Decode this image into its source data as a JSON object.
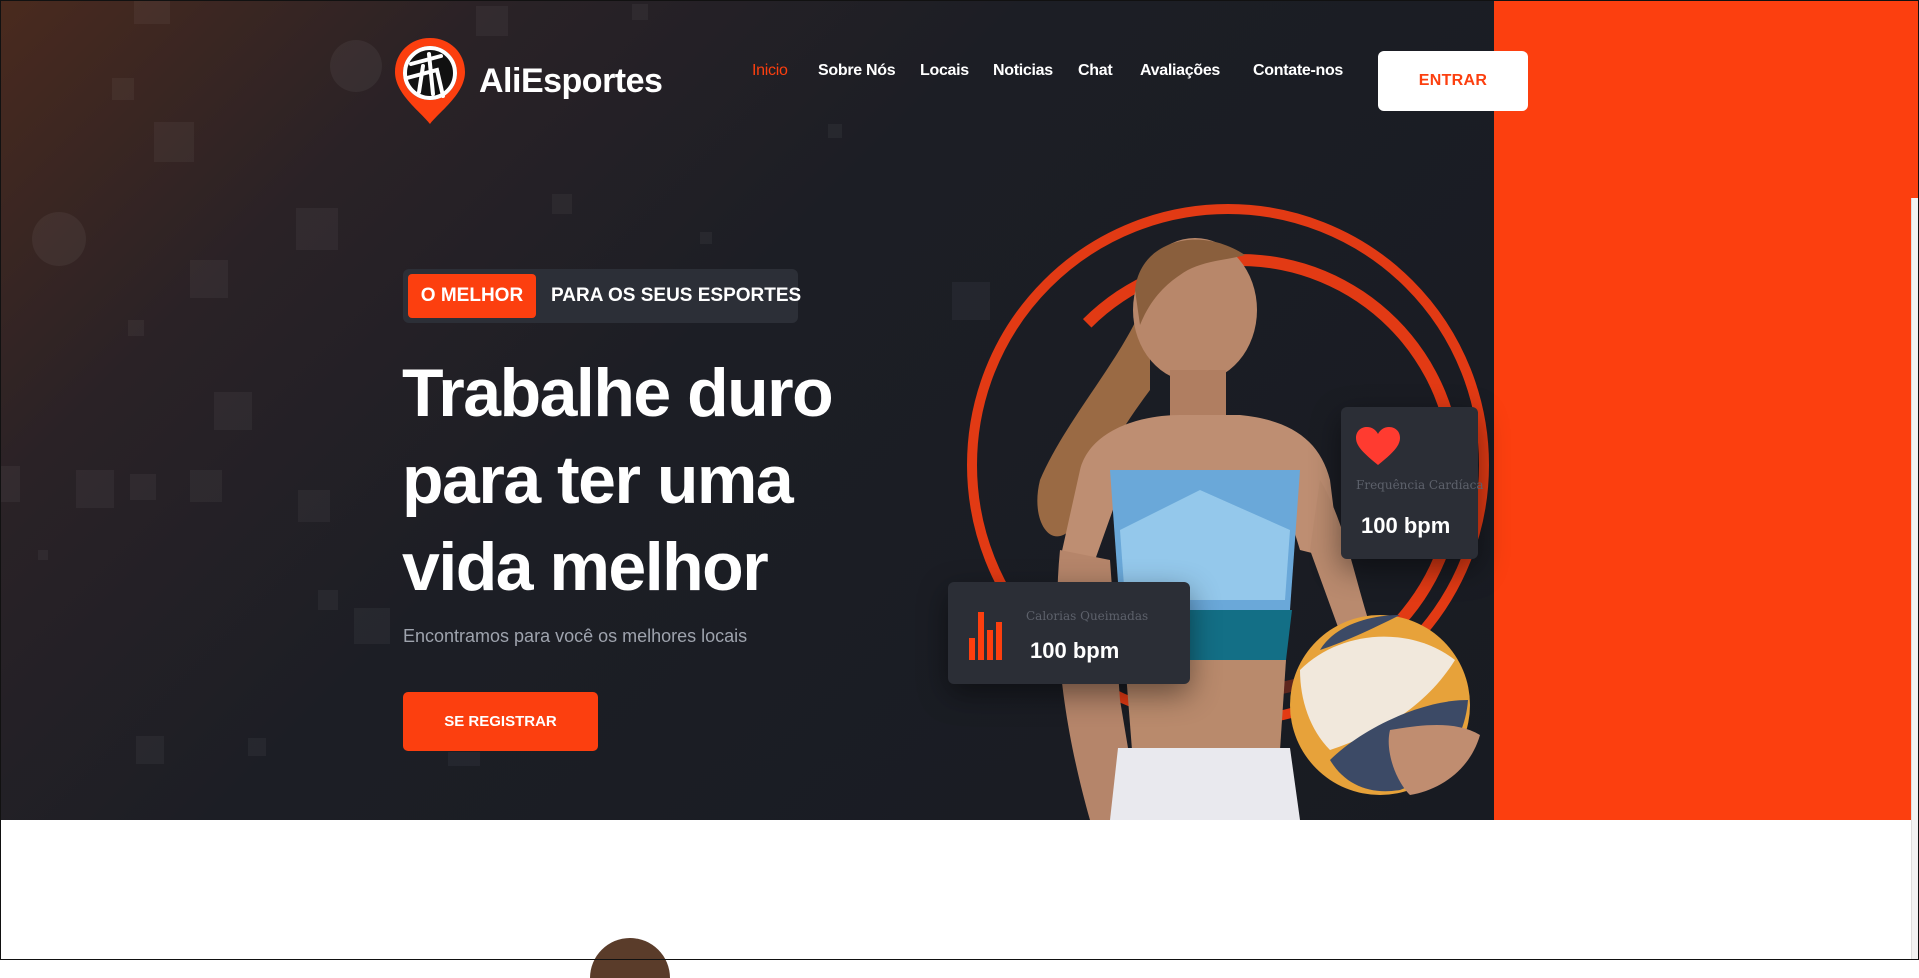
{
  "brand": {
    "name": "AliEsportes"
  },
  "nav": {
    "items": [
      {
        "label": "Inicio",
        "active": true
      },
      {
        "label": "Sobre Nós"
      },
      {
        "label": "Locais"
      },
      {
        "label": "Noticias"
      },
      {
        "label": "Chat"
      },
      {
        "label": "Avaliações"
      },
      {
        "label": "Contate-nos"
      }
    ],
    "login_label": "ENTRAR"
  },
  "hero": {
    "tag_highlight": "O MELHOR",
    "tag_rest": "PARA OS SEUS ESPORTES",
    "headline_lines": [
      "Trabalhe duro",
      "para ter uma",
      "vida melhor"
    ],
    "subtitle": "Encontramos para você os melhores locais",
    "cta_label": "SE REGISTRAR"
  },
  "cards": {
    "heart": {
      "label": "Frequência Cardíaca",
      "value": "100 bpm"
    },
    "calories": {
      "label": "Calorias Queimadas",
      "value": "100 bpm"
    }
  },
  "colors": {
    "accent": "#fc3f0f",
    "dark": "#171a21",
    "card": "#2b2e36"
  },
  "icons": {
    "logo": "volleyball-pin-icon",
    "heart": "heart-icon",
    "bars": "bar-chart-icon"
  }
}
